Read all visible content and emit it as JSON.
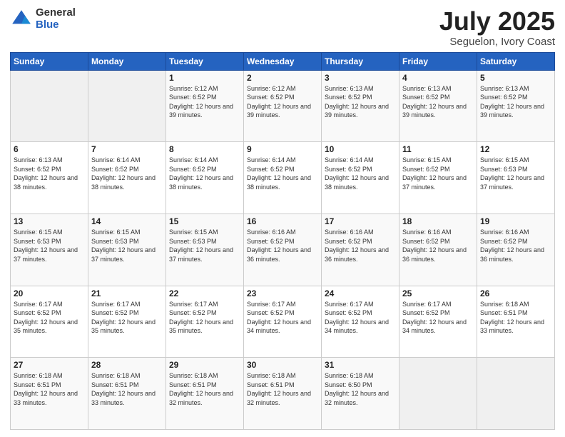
{
  "logo": {
    "general": "General",
    "blue": "Blue"
  },
  "header": {
    "title": "July 2025",
    "subtitle": "Seguelon, Ivory Coast"
  },
  "weekdays": [
    "Sunday",
    "Monday",
    "Tuesday",
    "Wednesday",
    "Thursday",
    "Friday",
    "Saturday"
  ],
  "weeks": [
    [
      {
        "day": "",
        "info": ""
      },
      {
        "day": "",
        "info": ""
      },
      {
        "day": "1",
        "info": "Sunrise: 6:12 AM\nSunset: 6:52 PM\nDaylight: 12 hours and 39 minutes."
      },
      {
        "day": "2",
        "info": "Sunrise: 6:12 AM\nSunset: 6:52 PM\nDaylight: 12 hours and 39 minutes."
      },
      {
        "day": "3",
        "info": "Sunrise: 6:13 AM\nSunset: 6:52 PM\nDaylight: 12 hours and 39 minutes."
      },
      {
        "day": "4",
        "info": "Sunrise: 6:13 AM\nSunset: 6:52 PM\nDaylight: 12 hours and 39 minutes."
      },
      {
        "day": "5",
        "info": "Sunrise: 6:13 AM\nSunset: 6:52 PM\nDaylight: 12 hours and 39 minutes."
      }
    ],
    [
      {
        "day": "6",
        "info": "Sunrise: 6:13 AM\nSunset: 6:52 PM\nDaylight: 12 hours and 38 minutes."
      },
      {
        "day": "7",
        "info": "Sunrise: 6:14 AM\nSunset: 6:52 PM\nDaylight: 12 hours and 38 minutes."
      },
      {
        "day": "8",
        "info": "Sunrise: 6:14 AM\nSunset: 6:52 PM\nDaylight: 12 hours and 38 minutes."
      },
      {
        "day": "9",
        "info": "Sunrise: 6:14 AM\nSunset: 6:52 PM\nDaylight: 12 hours and 38 minutes."
      },
      {
        "day": "10",
        "info": "Sunrise: 6:14 AM\nSunset: 6:52 PM\nDaylight: 12 hours and 38 minutes."
      },
      {
        "day": "11",
        "info": "Sunrise: 6:15 AM\nSunset: 6:52 PM\nDaylight: 12 hours and 37 minutes."
      },
      {
        "day": "12",
        "info": "Sunrise: 6:15 AM\nSunset: 6:53 PM\nDaylight: 12 hours and 37 minutes."
      }
    ],
    [
      {
        "day": "13",
        "info": "Sunrise: 6:15 AM\nSunset: 6:53 PM\nDaylight: 12 hours and 37 minutes."
      },
      {
        "day": "14",
        "info": "Sunrise: 6:15 AM\nSunset: 6:53 PM\nDaylight: 12 hours and 37 minutes."
      },
      {
        "day": "15",
        "info": "Sunrise: 6:15 AM\nSunset: 6:53 PM\nDaylight: 12 hours and 37 minutes."
      },
      {
        "day": "16",
        "info": "Sunrise: 6:16 AM\nSunset: 6:52 PM\nDaylight: 12 hours and 36 minutes."
      },
      {
        "day": "17",
        "info": "Sunrise: 6:16 AM\nSunset: 6:52 PM\nDaylight: 12 hours and 36 minutes."
      },
      {
        "day": "18",
        "info": "Sunrise: 6:16 AM\nSunset: 6:52 PM\nDaylight: 12 hours and 36 minutes."
      },
      {
        "day": "19",
        "info": "Sunrise: 6:16 AM\nSunset: 6:52 PM\nDaylight: 12 hours and 36 minutes."
      }
    ],
    [
      {
        "day": "20",
        "info": "Sunrise: 6:17 AM\nSunset: 6:52 PM\nDaylight: 12 hours and 35 minutes."
      },
      {
        "day": "21",
        "info": "Sunrise: 6:17 AM\nSunset: 6:52 PM\nDaylight: 12 hours and 35 minutes."
      },
      {
        "day": "22",
        "info": "Sunrise: 6:17 AM\nSunset: 6:52 PM\nDaylight: 12 hours and 35 minutes."
      },
      {
        "day": "23",
        "info": "Sunrise: 6:17 AM\nSunset: 6:52 PM\nDaylight: 12 hours and 34 minutes."
      },
      {
        "day": "24",
        "info": "Sunrise: 6:17 AM\nSunset: 6:52 PM\nDaylight: 12 hours and 34 minutes."
      },
      {
        "day": "25",
        "info": "Sunrise: 6:17 AM\nSunset: 6:52 PM\nDaylight: 12 hours and 34 minutes."
      },
      {
        "day": "26",
        "info": "Sunrise: 6:18 AM\nSunset: 6:51 PM\nDaylight: 12 hours and 33 minutes."
      }
    ],
    [
      {
        "day": "27",
        "info": "Sunrise: 6:18 AM\nSunset: 6:51 PM\nDaylight: 12 hours and 33 minutes."
      },
      {
        "day": "28",
        "info": "Sunrise: 6:18 AM\nSunset: 6:51 PM\nDaylight: 12 hours and 33 minutes."
      },
      {
        "day": "29",
        "info": "Sunrise: 6:18 AM\nSunset: 6:51 PM\nDaylight: 12 hours and 32 minutes."
      },
      {
        "day": "30",
        "info": "Sunrise: 6:18 AM\nSunset: 6:51 PM\nDaylight: 12 hours and 32 minutes."
      },
      {
        "day": "31",
        "info": "Sunrise: 6:18 AM\nSunset: 6:50 PM\nDaylight: 12 hours and 32 minutes."
      },
      {
        "day": "",
        "info": ""
      },
      {
        "day": "",
        "info": ""
      }
    ]
  ]
}
